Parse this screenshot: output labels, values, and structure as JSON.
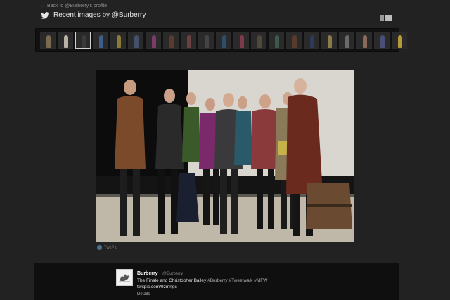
{
  "nav": {
    "back_label": "← Back to @Burberry's profile"
  },
  "header": {
    "title": "Recent images by @Burberry",
    "icon": "twitter-bird-icon"
  },
  "thumbnails": [
    {
      "color": "#7a6a4f"
    },
    {
      "color": "#b8b2a4"
    },
    {
      "color": "#3c3a38"
    },
    {
      "color": "#3d5d8a"
    },
    {
      "color": "#8c7a3a"
    },
    {
      "color": "#45506a"
    },
    {
      "color": "#7a3d6a"
    },
    {
      "color": "#5b3b2e"
    },
    {
      "color": "#6a4040"
    },
    {
      "color": "#444444"
    },
    {
      "color": "#2d4f6d"
    },
    {
      "color": "#7d3a4a"
    },
    {
      "color": "#50493b"
    },
    {
      "color": "#3b5a4a"
    },
    {
      "color": "#5a3a2a"
    },
    {
      "color": "#2e3a5a"
    },
    {
      "color": "#8b7a4a"
    },
    {
      "color": "#6a6a6a"
    },
    {
      "color": "#8a6a5a"
    },
    {
      "color": "#4a4f7a"
    },
    {
      "color": "#b59a3a"
    }
  ],
  "selected_thumbnail": 2,
  "photo": {
    "alt": "The Finale and Christopher Bailey"
  },
  "source": {
    "label": "TwitPic"
  },
  "tweet": {
    "name": "Burberry",
    "handle": "@Burberry",
    "text_lead": "The Finale and Christopher Bailey",
    "hashtags": [
      "#Burberry",
      "#Tweetwalk",
      "#MFW"
    ],
    "link": "twitpic.com/9zmngc",
    "details_label": "Details"
  },
  "colors": {
    "background": "#222222",
    "card": "#0f0f0f",
    "strip": "#111111"
  }
}
